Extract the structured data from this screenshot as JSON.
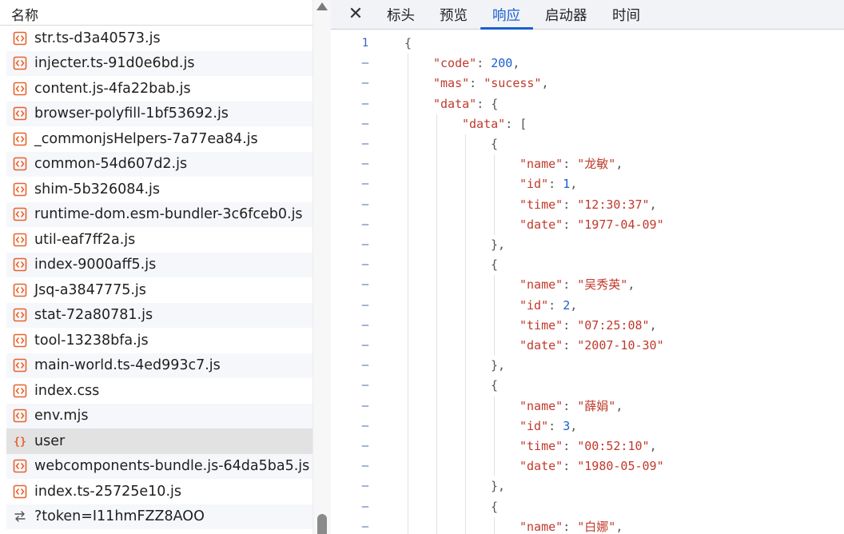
{
  "list": {
    "header": "名称",
    "items": [
      {
        "name": "str.ts-d3a40573.js",
        "type": "script"
      },
      {
        "name": "injecter.ts-91d0e6bd.js",
        "type": "script"
      },
      {
        "name": "content.js-4fa22bab.js",
        "type": "script"
      },
      {
        "name": "browser-polyfill-1bf53692.js",
        "type": "script"
      },
      {
        "name": "_commonjsHelpers-7a77ea84.js",
        "type": "script"
      },
      {
        "name": "common-54d607d2.js",
        "type": "script"
      },
      {
        "name": "shim-5b326084.js",
        "type": "script"
      },
      {
        "name": "runtime-dom.esm-bundler-3c6fceb0.js",
        "type": "script"
      },
      {
        "name": "util-eaf7ff2a.js",
        "type": "script"
      },
      {
        "name": "index-9000aff5.js",
        "type": "script"
      },
      {
        "name": "Jsq-a3847775.js",
        "type": "script"
      },
      {
        "name": "stat-72a80781.js",
        "type": "script"
      },
      {
        "name": "tool-13238bfa.js",
        "type": "script"
      },
      {
        "name": "main-world.ts-4ed993c7.js",
        "type": "script"
      },
      {
        "name": "index.css",
        "type": "script"
      },
      {
        "name": "env.mjs",
        "type": "script"
      },
      {
        "name": "user",
        "type": "json",
        "selected": true
      },
      {
        "name": "webcomponents-bundle.js-64da5ba5.js",
        "type": "script"
      },
      {
        "name": "index.ts-25725e10.js",
        "type": "script"
      },
      {
        "name": "?token=I11hmFZZ8AOO",
        "type": "fetch"
      }
    ]
  },
  "tabs": {
    "close_icon": "close-icon",
    "items": [
      "标头",
      "预览",
      "响应",
      "启动器",
      "时间"
    ],
    "active": "响应"
  },
  "response": {
    "first_line_number": "1",
    "collapse_marker": "–",
    "lines": [
      {
        "indent": 0,
        "tokens": [
          [
            "p",
            "{"
          ]
        ]
      },
      {
        "indent": 1,
        "tokens": [
          [
            "k",
            "\"code\""
          ],
          [
            "p",
            ": "
          ],
          [
            "n",
            "200"
          ],
          [
            "p",
            ","
          ]
        ]
      },
      {
        "indent": 1,
        "tokens": [
          [
            "k",
            "\"mas\""
          ],
          [
            "p",
            ": "
          ],
          [
            "s",
            "\"sucess\""
          ],
          [
            "p",
            ","
          ]
        ]
      },
      {
        "indent": 1,
        "tokens": [
          [
            "k",
            "\"data\""
          ],
          [
            "p",
            ": {"
          ]
        ]
      },
      {
        "indent": 2,
        "tokens": [
          [
            "k",
            "\"data\""
          ],
          [
            "p",
            ": ["
          ]
        ]
      },
      {
        "indent": 3,
        "tokens": [
          [
            "p",
            "{"
          ]
        ]
      },
      {
        "indent": 4,
        "tokens": [
          [
            "k",
            "\"name\""
          ],
          [
            "p",
            ": "
          ],
          [
            "s",
            "\"龙敏\""
          ],
          [
            "p",
            ","
          ]
        ]
      },
      {
        "indent": 4,
        "tokens": [
          [
            "k",
            "\"id\""
          ],
          [
            "p",
            ": "
          ],
          [
            "n",
            "1"
          ],
          [
            "p",
            ","
          ]
        ]
      },
      {
        "indent": 4,
        "tokens": [
          [
            "k",
            "\"time\""
          ],
          [
            "p",
            ": "
          ],
          [
            "s",
            "\"12:30:37\""
          ],
          [
            "p",
            ","
          ]
        ]
      },
      {
        "indent": 4,
        "tokens": [
          [
            "k",
            "\"date\""
          ],
          [
            "p",
            ": "
          ],
          [
            "s",
            "\"1977-04-09\""
          ]
        ]
      },
      {
        "indent": 3,
        "tokens": [
          [
            "p",
            "},"
          ]
        ]
      },
      {
        "indent": 3,
        "tokens": [
          [
            "p",
            "{"
          ]
        ]
      },
      {
        "indent": 4,
        "tokens": [
          [
            "k",
            "\"name\""
          ],
          [
            "p",
            ": "
          ],
          [
            "s",
            "\"吴秀英\""
          ],
          [
            "p",
            ","
          ]
        ]
      },
      {
        "indent": 4,
        "tokens": [
          [
            "k",
            "\"id\""
          ],
          [
            "p",
            ": "
          ],
          [
            "n",
            "2"
          ],
          [
            "p",
            ","
          ]
        ]
      },
      {
        "indent": 4,
        "tokens": [
          [
            "k",
            "\"time\""
          ],
          [
            "p",
            ": "
          ],
          [
            "s",
            "\"07:25:08\""
          ],
          [
            "p",
            ","
          ]
        ]
      },
      {
        "indent": 4,
        "tokens": [
          [
            "k",
            "\"date\""
          ],
          [
            "p",
            ": "
          ],
          [
            "s",
            "\"2007-10-30\""
          ]
        ]
      },
      {
        "indent": 3,
        "tokens": [
          [
            "p",
            "},"
          ]
        ]
      },
      {
        "indent": 3,
        "tokens": [
          [
            "p",
            "{"
          ]
        ]
      },
      {
        "indent": 4,
        "tokens": [
          [
            "k",
            "\"name\""
          ],
          [
            "p",
            ": "
          ],
          [
            "s",
            "\"薛娟\""
          ],
          [
            "p",
            ","
          ]
        ]
      },
      {
        "indent": 4,
        "tokens": [
          [
            "k",
            "\"id\""
          ],
          [
            "p",
            ": "
          ],
          [
            "n",
            "3"
          ],
          [
            "p",
            ","
          ]
        ]
      },
      {
        "indent": 4,
        "tokens": [
          [
            "k",
            "\"time\""
          ],
          [
            "p",
            ": "
          ],
          [
            "s",
            "\"00:52:10\""
          ],
          [
            "p",
            ","
          ]
        ]
      },
      {
        "indent": 4,
        "tokens": [
          [
            "k",
            "\"date\""
          ],
          [
            "p",
            ": "
          ],
          [
            "s",
            "\"1980-05-09\""
          ]
        ]
      },
      {
        "indent": 3,
        "tokens": [
          [
            "p",
            "},"
          ]
        ]
      },
      {
        "indent": 3,
        "tokens": [
          [
            "p",
            "{"
          ]
        ]
      },
      {
        "indent": 4,
        "tokens": [
          [
            "k",
            "\"name\""
          ],
          [
            "p",
            ": "
          ],
          [
            "s",
            "\"白娜\""
          ],
          [
            "p",
            ","
          ]
        ]
      }
    ]
  },
  "colors": {
    "accent": "#1a5fd0",
    "json_key": "#c0392b",
    "json_string": "#c0392b",
    "json_number": "#1a5fd0",
    "script_icon": "#e8622c",
    "json_icon": "#e8622c",
    "fetch_icon": "#555555"
  }
}
